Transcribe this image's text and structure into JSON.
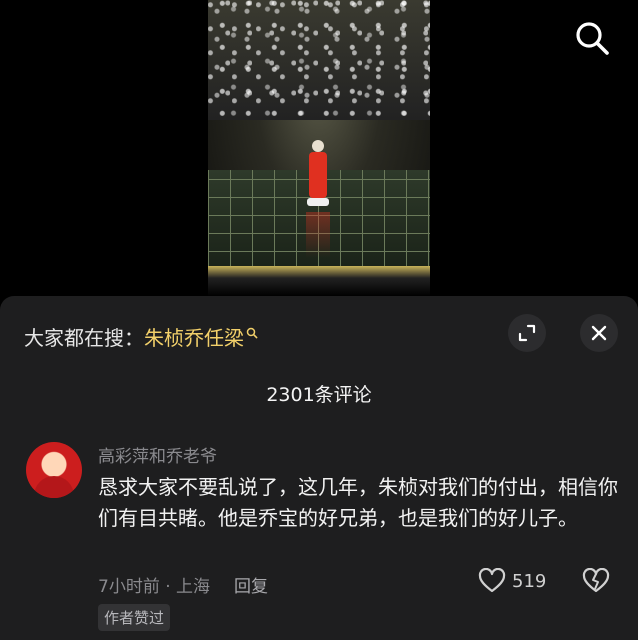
{
  "header": {
    "search_icon": "search-icon"
  },
  "panel": {
    "search_prefix": "大家都在搜：",
    "search_keyword": "朱桢乔任梁",
    "comment_count": "2301条评论",
    "expand_icon": "expand-icon",
    "close_icon": "close-icon"
  },
  "comment": {
    "username": "高彩萍和乔老爷",
    "text": "恳求大家不要乱说了，这几年，朱桢对我们的付出，相信你们有目共睹。他是乔宝的好兄弟，也是我们的好儿子。",
    "time_location": "7小时前 · 上海",
    "reply_label": "回复",
    "likes": "519",
    "author_badge": "作者赞过"
  },
  "colors": {
    "keyword": "#f2d06a",
    "panel_bg": "#1e1e1f",
    "muted": "#8a8a8e"
  }
}
